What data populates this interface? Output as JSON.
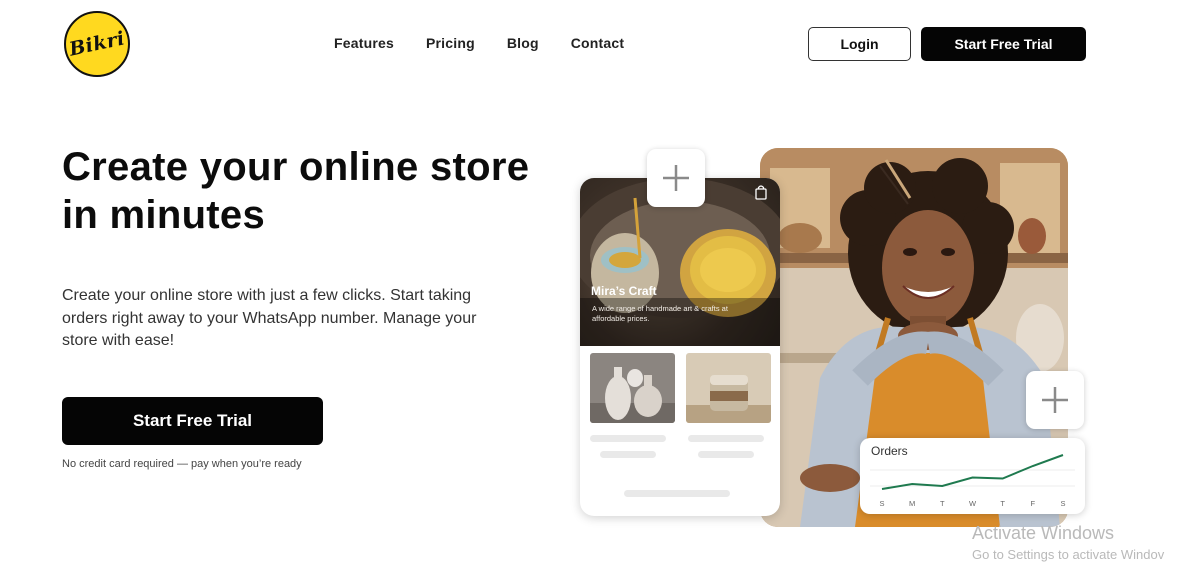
{
  "brand": {
    "logo_text": "Bikri",
    "accent": "#ffd91f"
  },
  "nav": {
    "items": [
      "Features",
      "Pricing",
      "Blog",
      "Contact"
    ]
  },
  "header": {
    "login_label": "Login",
    "trial_label": "Start Free Trial"
  },
  "hero": {
    "title": "Create your online store in minutes",
    "description": "Create your online store with just a few clicks. Start taking orders right away to your WhatsApp number. Manage your store with ease!",
    "cta_label": "Start Free Trial",
    "note": "No credit card required — pay when you’re ready"
  },
  "store_preview": {
    "name": "Mira’s Craft",
    "tagline": "A wide range of handmade art & crafts at affordable prices."
  },
  "orders_card": {
    "title": "Orders",
    "days": [
      "S",
      "M",
      "T",
      "W",
      "T",
      "F",
      "S"
    ],
    "values": [
      1,
      2,
      1.6,
      3.3,
      3.1,
      5.6,
      7.8
    ],
    "line_color": "#1f7a4f"
  },
  "watermark": {
    "line1": "Activate Windows",
    "line2": "Go to Settings to activate Windov"
  }
}
